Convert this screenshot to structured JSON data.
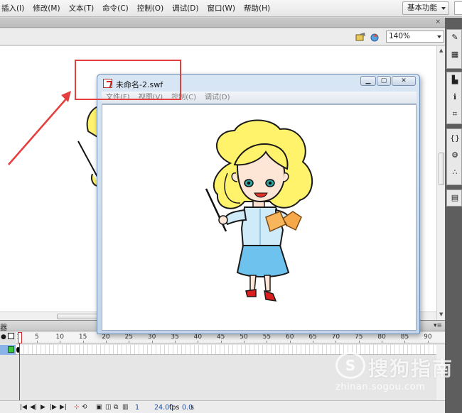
{
  "menubar": {
    "items": [
      "插入(I)",
      "修改(M)",
      "文本(T)",
      "命令(C)",
      "控制(O)",
      "调试(D)",
      "窗口(W)",
      "帮助(H)"
    ],
    "workspace_label": "基本功能"
  },
  "edit_bar": {
    "zoom": "140%"
  },
  "swf_window": {
    "title": "未命名-2.swf",
    "menu": [
      "文件(F)",
      "视图(V)",
      "控制(C)",
      "调试(D)"
    ],
    "buttons": [
      "minimize",
      "maximize",
      "close"
    ]
  },
  "timeline": {
    "panel_label": "器",
    "ruler_numbers": [
      "1",
      "5",
      "10",
      "15",
      "20",
      "25",
      "30",
      "35",
      "40",
      "45",
      "50",
      "55",
      "60",
      "65",
      "70",
      "75",
      "80",
      "85",
      "90"
    ],
    "current_frame": "1",
    "fps_value": "24.00",
    "fps_unit": "fps",
    "time_value": "0.0",
    "time_unit": "s"
  },
  "right_panel": {
    "icons": [
      "brush-icon",
      "swatch-grid-icon",
      "align-icon",
      "info-icon",
      "transform-icon",
      "code-icon",
      "components-icon",
      "motion-icon",
      "library-icon"
    ]
  },
  "annotation": {
    "color": "#e53e3e"
  },
  "watermark": {
    "brand": "搜狗指南",
    "url": "zhinan.sogou.com"
  }
}
